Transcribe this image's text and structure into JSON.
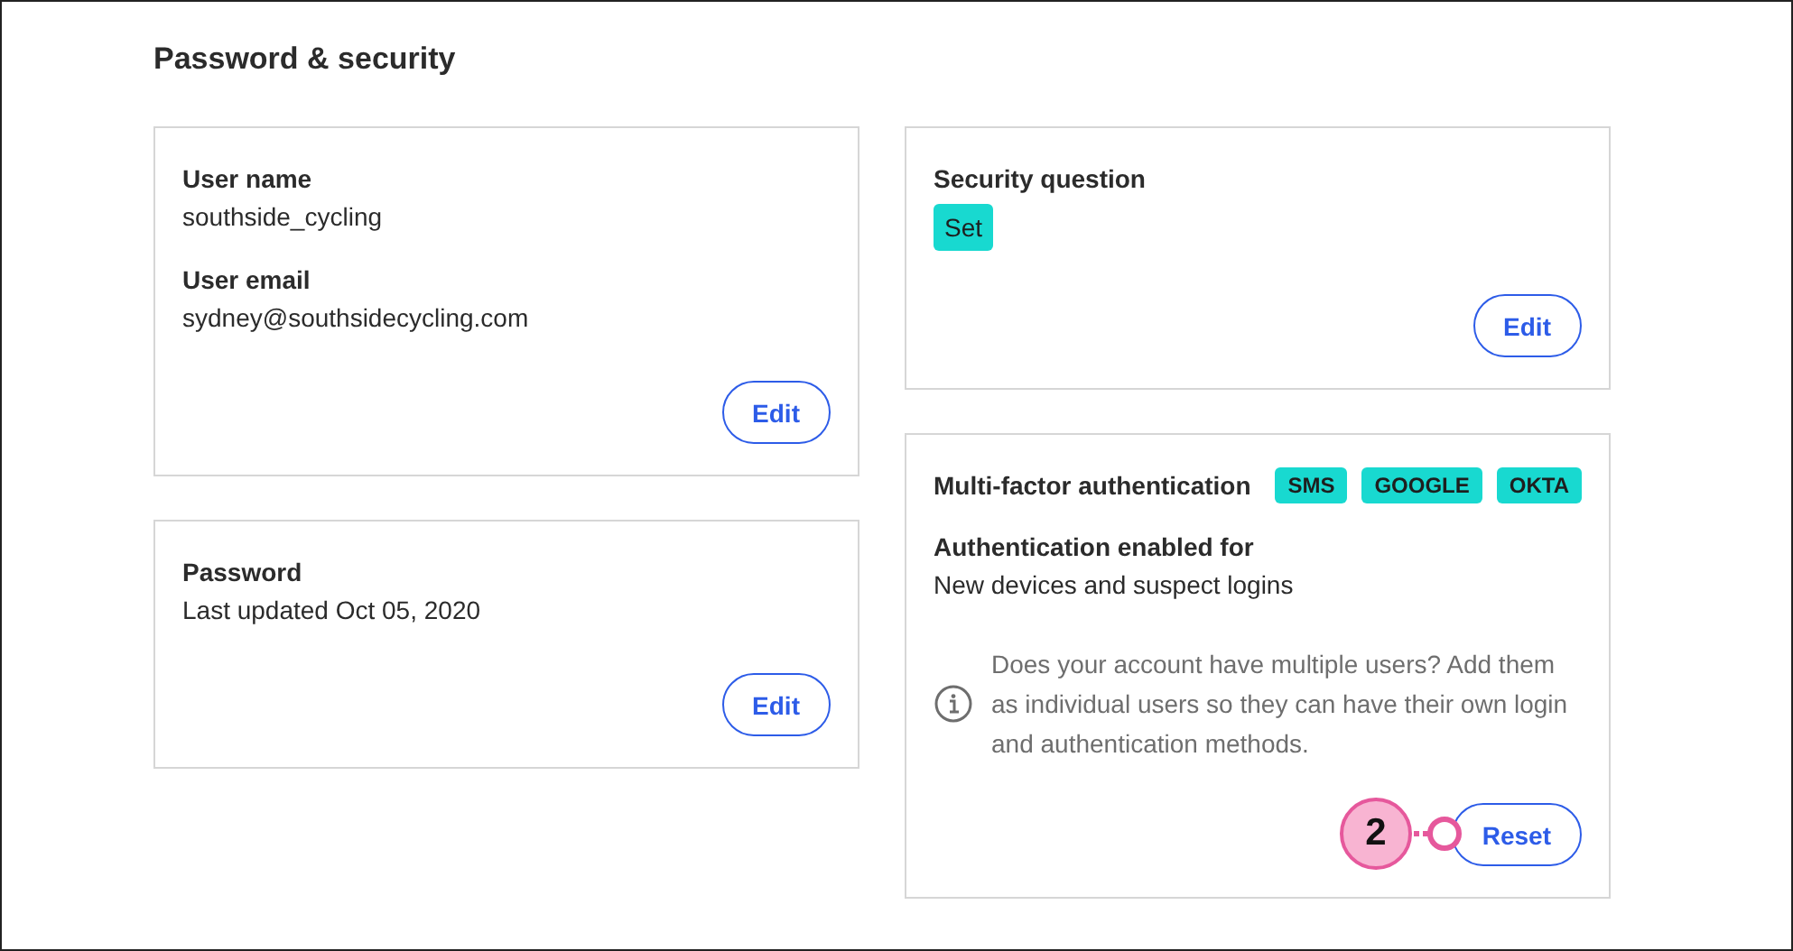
{
  "title": "Password & security",
  "columns": [
    [
      {
        "fields": [
          {
            "label": "User name",
            "value": "southside_cycling"
          },
          {
            "label": "User email",
            "value": "sydney@southsidecycling.com"
          }
        ],
        "button": "Edit"
      },
      {
        "fields": [
          {
            "label": "Password",
            "value": "Last updated Oct 05, 2020"
          }
        ],
        "button": "Edit"
      }
    ],
    [
      {
        "fields": [
          {
            "label": "Security question",
            "kind": "stacked",
            "tags": [
              "Set"
            ]
          }
        ],
        "button": "Edit"
      },
      {
        "fields": [
          {
            "label": "Multi-factor authentication",
            "kind": "inline",
            "tags": [
              "SMS",
              "GOOGLE",
              "OKTA"
            ]
          },
          {
            "label": "Authentication enabled for",
            "value": "New devices and suspect logins"
          }
        ],
        "note": "Does your account have multiple users? Add them as individual users so they can have their own login and authentication methods.",
        "button": "Reset",
        "callout": "2"
      }
    ]
  ]
}
